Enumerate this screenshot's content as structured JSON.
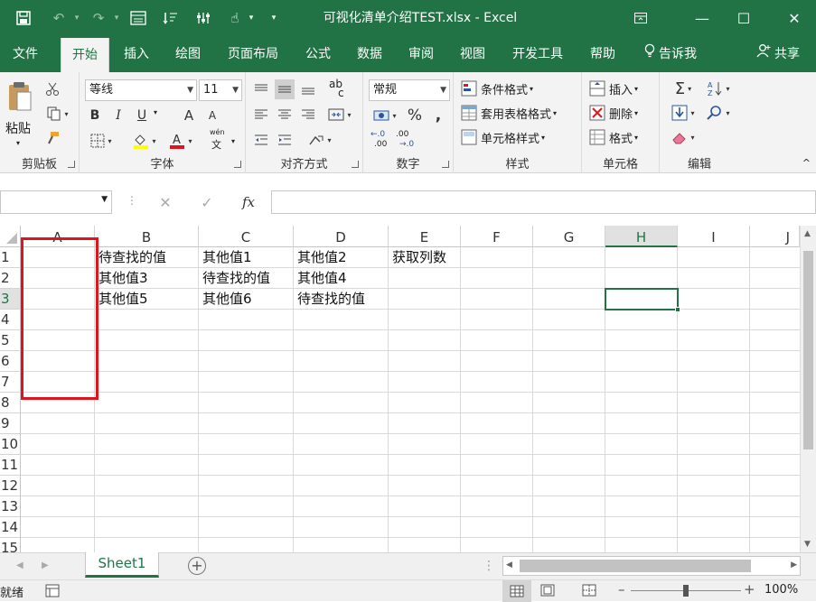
{
  "window": {
    "title": "可视化清单介绍TEST.xlsx  -  Excel",
    "restore_icon": "ribbon-display-icon",
    "minimize_label": "—",
    "maximize_label": "☐",
    "close_label": "✕"
  },
  "tabs": [
    "文件",
    "开始",
    "插入",
    "绘图",
    "页面布局",
    "公式",
    "数据",
    "审阅",
    "视图",
    "开发工具",
    "帮助"
  ],
  "tell_me": "告诉我",
  "share": "共享",
  "ribbon": {
    "clipboard": {
      "label": "剪贴板",
      "paste": "粘贴"
    },
    "font": {
      "label": "字体",
      "font_name": "等线",
      "font_size": "11",
      "bold": "B",
      "italic": "I",
      "underline": "U",
      "grow": "A",
      "shrink": "A",
      "phonetic_top": "wén",
      "phonetic_bottom": "文"
    },
    "alignment": {
      "label": "对齐方式",
      "orient": "ab",
      "orient_sub": "c"
    },
    "number": {
      "label": "数字",
      "format": "常规",
      "percent": "%",
      "comma": ",",
      "inc_top": "←.0",
      "inc_bottom": ".00",
      "dec_top": ".00",
      "dec_bottom": "→.0"
    },
    "styles": {
      "label": "样式",
      "conditional": "条件格式",
      "table": "套用表格格式",
      "cell": "单元格样式"
    },
    "cells": {
      "label": "单元格",
      "insert": "插入",
      "delete": "删除",
      "format": "格式"
    },
    "editing": {
      "label": "编辑",
      "sum": "Σ"
    }
  },
  "formula_bar": {
    "name_box": "",
    "cancel": "✕",
    "enter": "✓",
    "fx": "fx",
    "value": ""
  },
  "columns": [
    "A",
    "B",
    "C",
    "D",
    "E",
    "F",
    "G",
    "H",
    "I",
    "J"
  ],
  "rows": [
    "1",
    "2",
    "3",
    "4",
    "5",
    "6",
    "7",
    "8",
    "9",
    "10",
    "11",
    "12",
    "13",
    "14",
    "15"
  ],
  "cells": {
    "B1": "待查找的值",
    "C1": "其他值1",
    "D1": "其他值2",
    "E1": "获取列数",
    "B2": "其他值3",
    "C2": "待查找的值",
    "D2": "其他值4",
    "B3": "其他值5",
    "C3": "其他值6",
    "D3": "待查找的值"
  },
  "selected_cell": "H3",
  "sheet_tab": "Sheet1",
  "status": {
    "ready": "就绪",
    "zoom": "100%"
  },
  "colors": {
    "excel_green": "#217346",
    "highlight_red": "#e0141e",
    "font_red": "#e0141e",
    "fill_yellow": "#ffff00"
  }
}
